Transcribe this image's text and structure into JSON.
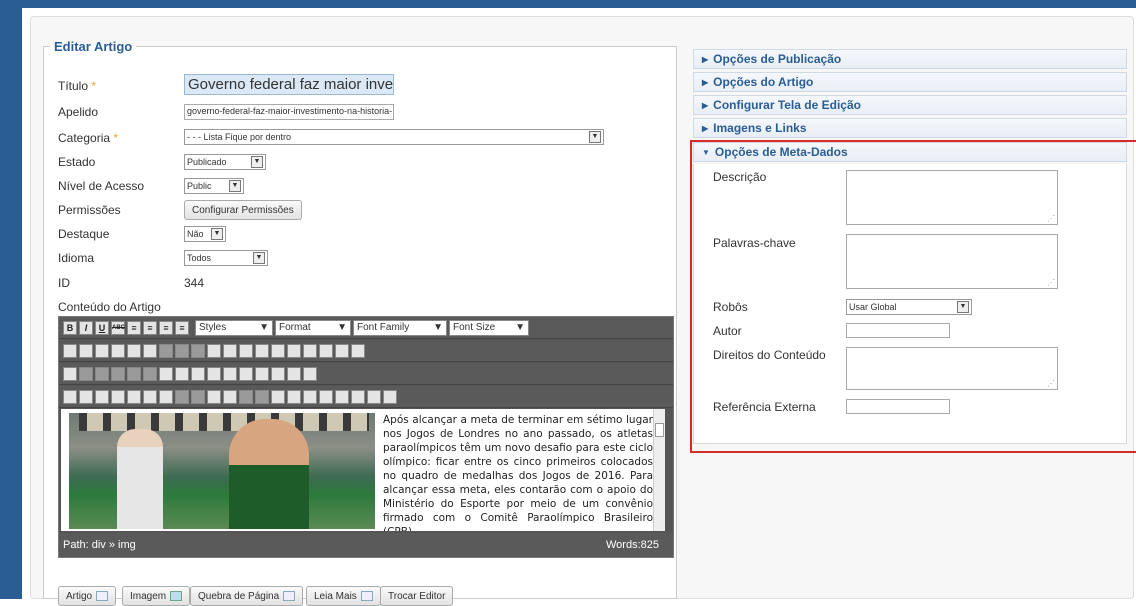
{
  "form": {
    "legend": "Editar Artigo",
    "required_mark": "*",
    "titulo": {
      "label": "Título",
      "value": "Governo federal faz maior investim"
    },
    "apelido": {
      "label": "Apelido",
      "value": "governo-federal-faz-maior-investimento-na-historia-"
    },
    "categoria": {
      "label": "Categoria",
      "value": "- - - Lista Fique por dentro"
    },
    "estado": {
      "label": "Estado",
      "value": "Publicado"
    },
    "nivel": {
      "label": "Nível de Acesso",
      "value": "Public"
    },
    "permissoes": {
      "label": "Permissões",
      "button": "Configurar Permissões"
    },
    "destaque": {
      "label": "Destaque",
      "value": "Não"
    },
    "idioma": {
      "label": "Idioma",
      "value": "Todos"
    },
    "id": {
      "label": "ID",
      "value": "344"
    },
    "conteudo_label": "Conteúdo do Artigo"
  },
  "editor": {
    "selects": {
      "styles": "Styles",
      "format": "Format",
      "font_family": "Font Family",
      "font_size": "Font Size"
    },
    "toolbar_row1_glyphs": [
      "B",
      "I",
      "U",
      "ABC",
      "≡",
      "≡",
      "≡",
      "≡"
    ],
    "text": "Após alcançar a meta de terminar em sétimo lugar nos Jogos de Londres no ano passado, os atletas paraolímpicos têm um novo desafio para este ciclo olímpico: ficar entre os cinco primeiros colocados no quadro de medalhas dos Jogos de 2016. Para alcançar essa meta, eles contarão com o apoio do Ministério do Esporte por meio de um convênio firmado com o Comitê Paraolímpico Brasileiro (CPB)",
    "path": "Path: div » img",
    "words": "Words:825"
  },
  "bottom_buttons": [
    "Artigo",
    "Imagem",
    "Quebra de Página",
    "Leia Mais",
    "Trocar Editor"
  ],
  "panels": [
    "Opções de Publicação",
    "Opções do Artigo",
    "Configurar Tela de Edição",
    "Imagens e Links",
    "Opções de Meta-Dados"
  ],
  "meta": {
    "descricao": "Descrição",
    "palavras": "Palavras-chave",
    "robos": "Robôs",
    "robos_value": "Usar Global",
    "autor": "Autor",
    "direitos": "Direitos do Conteúdo",
    "referencia": "Referência Externa"
  },
  "colors": {
    "accent": "#2a5d94",
    "highlight_border": "#d92a2a"
  }
}
